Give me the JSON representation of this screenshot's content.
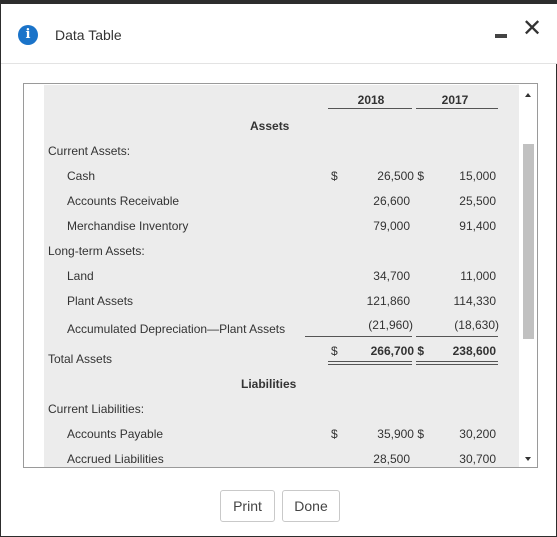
{
  "window": {
    "title": "Data Table",
    "info_icon": "i",
    "close_glyph": "✕"
  },
  "table": {
    "year_headers": [
      "2018",
      "2017"
    ],
    "assets_heading": "Assets",
    "current_assets_label": "Current Assets:",
    "cash_label": "Cash",
    "cash_dollar": "$",
    "cash_2018": "26,500 $",
    "cash_2017": "15,000",
    "ar_label": "Accounts Receivable",
    "ar_2018": "26,600",
    "ar_2017": "25,500",
    "inv_label": "Merchandise Inventory",
    "inv_2018": "79,000",
    "inv_2017": "91,400",
    "lta_label": "Long-term Assets:",
    "land_label": "Land",
    "land_2018": "34,700",
    "land_2017": "11,000",
    "plant_label": "Plant Assets",
    "plant_2018": "121,860",
    "plant_2017": "114,330",
    "accdep_label": "Accumulated Depreciation—Plant Assets",
    "accdep_2018": "(21,960)",
    "accdep_2017": "(18,630)",
    "total_label": "Total Assets",
    "total_dollar": "$",
    "total_2018": "266,700 $",
    "total_2017": "238,600",
    "liabilities_heading": "Liabilities",
    "current_liab_label": "Current Liabilities:",
    "ap_label": "Accounts Payable",
    "ap_dollar": "$",
    "ap_2018": "35,900 $",
    "ap_2017": "30,200",
    "accrued_label": "Accrued Liabilities",
    "accrued_2018": "28,500",
    "accrued_2017": "30,700"
  },
  "buttons": {
    "print": "Print",
    "done": "Done"
  }
}
